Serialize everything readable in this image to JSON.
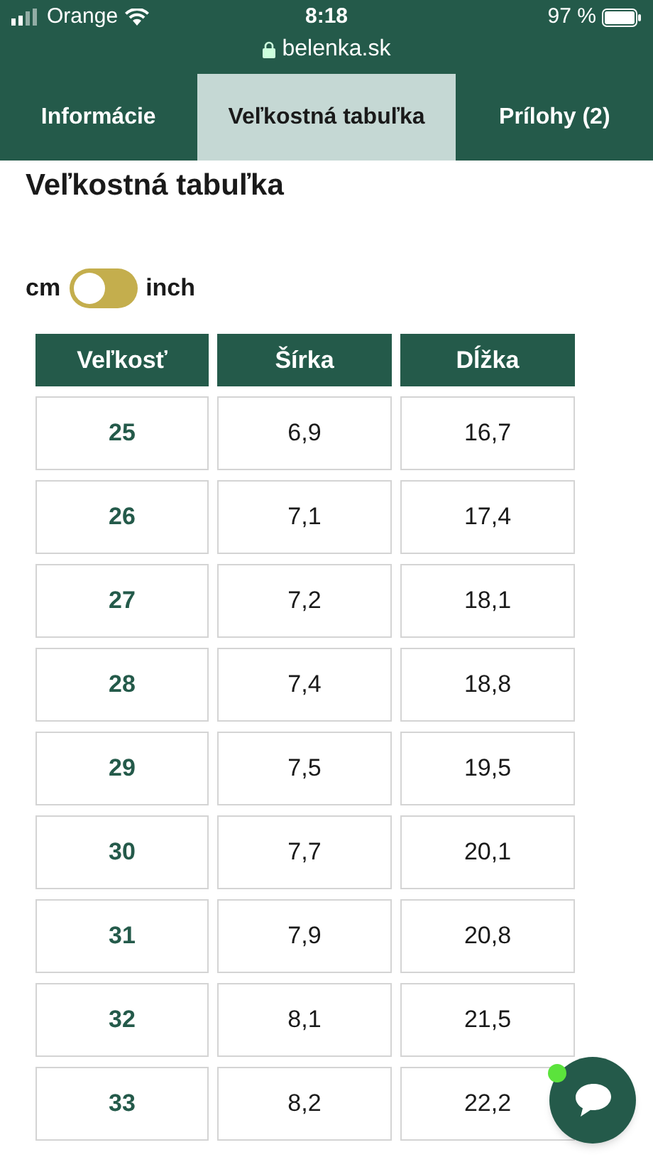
{
  "status_bar": {
    "carrier": "Orange",
    "time": "8:18",
    "url": "belenka.sk",
    "battery": "97 %"
  },
  "tabs": [
    {
      "label": "Informácie",
      "selected": false
    },
    {
      "label": "Veľkostná tabuľka",
      "selected": true
    },
    {
      "label": "Prílohy (2)",
      "selected": false
    }
  ],
  "title": "Veľkostná tabuľka",
  "unit_toggle": {
    "left_label": "cm",
    "right_label": "inch",
    "on": false
  },
  "table": {
    "columns": [
      "Veľkosť",
      "Šírka",
      "Dĺžka"
    ],
    "rows": [
      [
        "25",
        "6,9",
        "16,7"
      ],
      [
        "26",
        "7,1",
        "17,4"
      ],
      [
        "27",
        "7,2",
        "18,1"
      ],
      [
        "28",
        "7,4",
        "18,8"
      ],
      [
        "29",
        "7,5",
        "19,5"
      ],
      [
        "30",
        "7,7",
        "20,1"
      ],
      [
        "31",
        "7,9",
        "20,8"
      ],
      [
        "32",
        "8,1",
        "21,5"
      ],
      [
        "33",
        "8,2",
        "22,2"
      ]
    ]
  },
  "chat_button": {
    "online": true
  }
}
